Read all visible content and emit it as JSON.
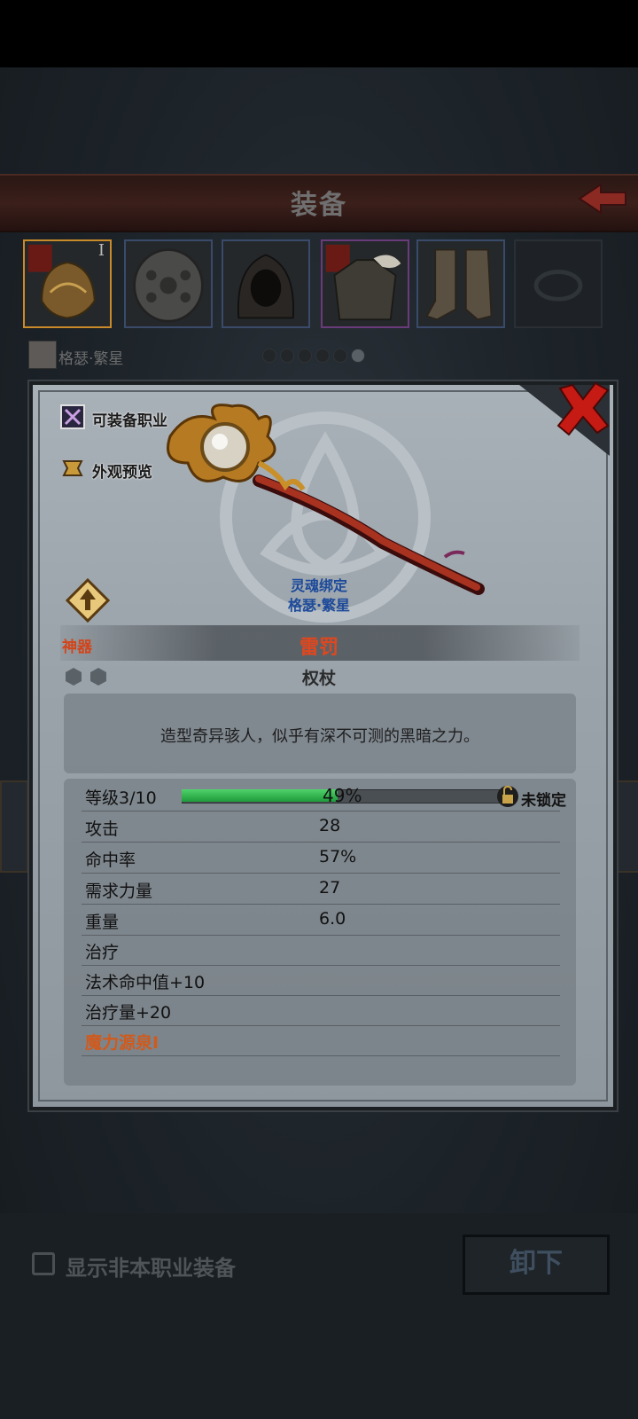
{
  "header": {
    "title": "装备"
  },
  "character": {
    "name": "格瑟·繁星"
  },
  "slots": [
    {
      "roman": "I"
    }
  ],
  "modal": {
    "equip_class_label": "可装备职业",
    "appearance_label": "外观预览",
    "soulbound": {
      "line1": "灵魂绑定",
      "line2": "格瑟·繁星"
    },
    "rarity": "神器",
    "item_name": "雷罚",
    "item_type": "权杖",
    "description": "造型奇异骇人，似乎有深不可测的黑暗之力。",
    "level": {
      "label": "等级3/10",
      "progress_percent": 49,
      "progress_text": "49%"
    },
    "lock_label": "未锁定",
    "stats": [
      {
        "name": "攻击",
        "value": "28"
      },
      {
        "name": "命中率",
        "value": "57%"
      },
      {
        "name": "需求力量",
        "value": "27"
      },
      {
        "name": "重量",
        "value": "6.0"
      }
    ],
    "effects": [
      "治疗",
      "法术命中值+10",
      "治疗量+20"
    ],
    "special": "魔力源泉I"
  },
  "bottom": {
    "show_non_class_label": "显示非本职业装备",
    "unequip_label": "卸下"
  },
  "colors": {
    "rarity": "#d2451b",
    "soulbound": "#1d4a9a",
    "progress": "#1e9a3a"
  }
}
